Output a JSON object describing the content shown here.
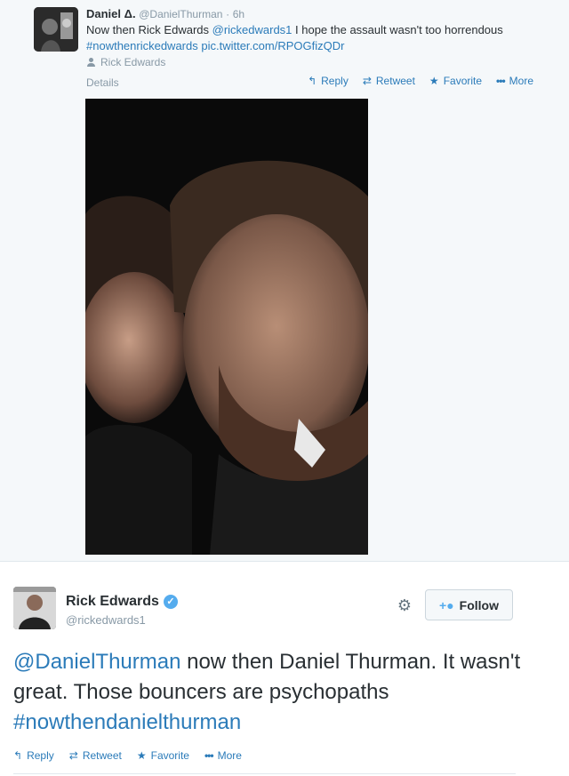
{
  "tweet1": {
    "author_name": "Daniel Δ.",
    "author_handle": "@DanielThurman",
    "separator": "·",
    "time": "6h",
    "text_1": "Now then Rick Edwards ",
    "mention": "@rickedwards1",
    "text_2": " I hope the assault wasn't too horrendous ",
    "hashtag": "#nowthenrickedwards",
    "text_3": " ",
    "pic_link": "pic.twitter.com/RPOGfizQDr",
    "tagged_user": "Rick Edwards",
    "details_label": "Details",
    "actions": {
      "reply": "Reply",
      "retweet": "Retweet",
      "favorite": "Favorite",
      "more": "More"
    }
  },
  "tweet2": {
    "author_name": "Rick Edwards",
    "author_handle": "@rickedwards1",
    "follow_label": "Follow",
    "mention": "@DanielThurman",
    "text_1": " now then Daniel Thurman. It wasn't great. Those bouncers are psychopaths ",
    "hashtag": "#nowthendanielthurman",
    "actions": {
      "reply": "Reply",
      "retweet": "Retweet",
      "favorite": "Favorite",
      "more": "More"
    }
  },
  "icons": {
    "reply": "reply-icon",
    "retweet": "retweet-icon",
    "favorite": "star-icon",
    "more": "more-dots-icon",
    "gear": "gear-icon",
    "follow": "add-user-icon",
    "verified": "verified-badge-icon"
  },
  "colors": {
    "link": "#2b7bb9",
    "muted": "#8899a6",
    "verified": "#55acee",
    "background_top": "#f5f8fa"
  }
}
